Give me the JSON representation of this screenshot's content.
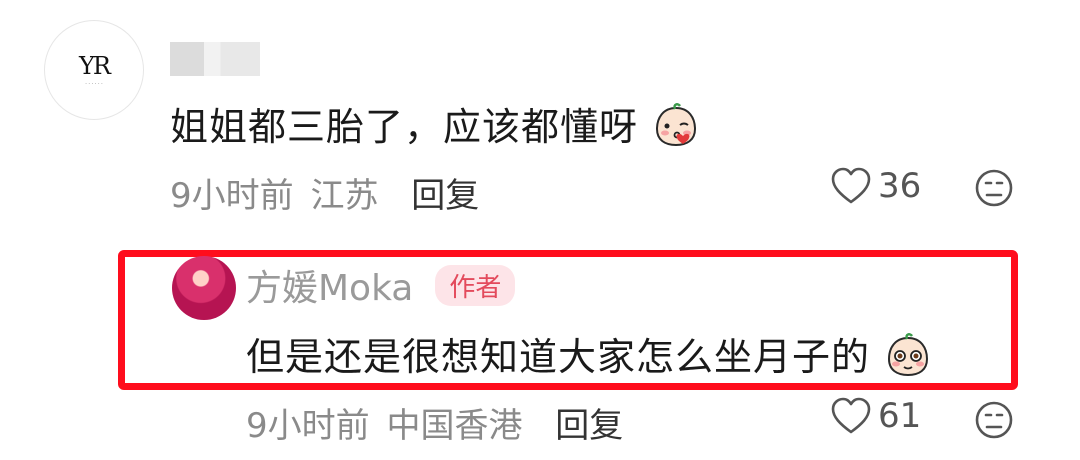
{
  "comment": {
    "avatar_text": "YR",
    "text": "姐姐都三胎了，应该都懂呀",
    "emoji": "blush-kiss-emoji",
    "time": "9小时前",
    "location": "江苏",
    "reply_label": "回复",
    "like_count": "36"
  },
  "reply": {
    "author_name": "方媛Moka",
    "author_badge": "作者",
    "text": "但是还是很想知道大家怎么坐月子的",
    "emoji": "pleading-emoji",
    "time": "9小时前",
    "location": "中国香港",
    "reply_label": "回复",
    "like_count": "61"
  },
  "colors": {
    "highlight_border": "#ff0d1d",
    "badge_bg": "#fde4e8",
    "badge_text": "#e34a5c",
    "meta_text": "#8a8a8a"
  }
}
